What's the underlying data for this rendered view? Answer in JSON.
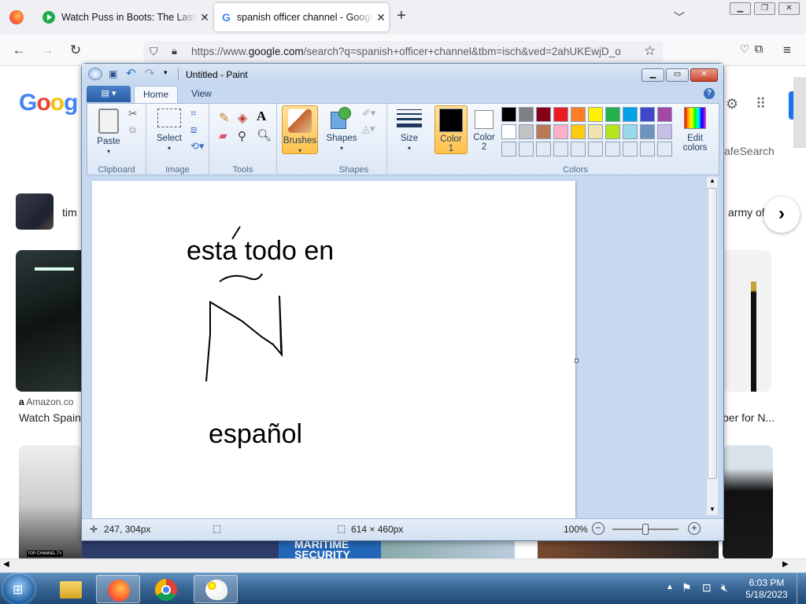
{
  "browser": {
    "tabs": [
      {
        "label": "Watch Puss in Boots: The Last Wish",
        "icon": "play-icon"
      },
      {
        "label": "spanish officer channel - Google Search",
        "icon": "google-icon",
        "active": true
      }
    ],
    "url_prefix": "https://www.",
    "url_domain": "google.com",
    "url_rest": "/search?q=spanish+officer+channel&tbm=isch&ved=2ahUKEwjD_o"
  },
  "google": {
    "logo": "Goog",
    "safesearch": "afeSearch",
    "chip_left": "tim",
    "chip_right": "army of",
    "result_source": "Amazon.co",
    "result_title_left": "Watch Spain",
    "result_title_right": "ber for N...",
    "thumb_text_1": "MARITIME",
    "thumb_text_2": "SECURITY",
    "thumb_text_3": "TOP-CHANNEL.TV"
  },
  "paint": {
    "title": "Untitled - Paint",
    "tabs": {
      "file": "",
      "home": "Home",
      "view": "View"
    },
    "groups": {
      "clipboard": "Clipboard",
      "image": "Image",
      "tools": "Tools",
      "shapes": "Shapes",
      "colors": "Colors"
    },
    "buttons": {
      "paste": "Paste",
      "select": "Select",
      "brushes": "Brushes",
      "shapes": "Shapes",
      "size": "Size",
      "color1": "Color",
      "color1_num": "1",
      "color2": "Color",
      "color2_num": "2",
      "edit_colors_1": "Edit",
      "edit_colors_2": "colors"
    },
    "palette_row1": [
      "#000000",
      "#7f7f7f",
      "#880015",
      "#ed1c24",
      "#ff7f27",
      "#fff200",
      "#22b14c",
      "#00a2e8",
      "#3f48cc",
      "#a349a4"
    ],
    "palette_row2": [
      "#ffffff",
      "#c3c3c3",
      "#b97a57",
      "#ffaec9",
      "#ffc90e",
      "#efe4b0",
      "#b5e61d",
      "#99d9ea",
      "#7092be",
      "#c8bfe7"
    ],
    "canvas_text": {
      "line1": "esta todo en",
      "line2": "español"
    },
    "status": {
      "cursor": "247, 304px",
      "size": "614 × 460px",
      "zoom": "100%"
    }
  },
  "taskbar": {
    "time": "6:03 PM",
    "date": "5/18/2023"
  }
}
